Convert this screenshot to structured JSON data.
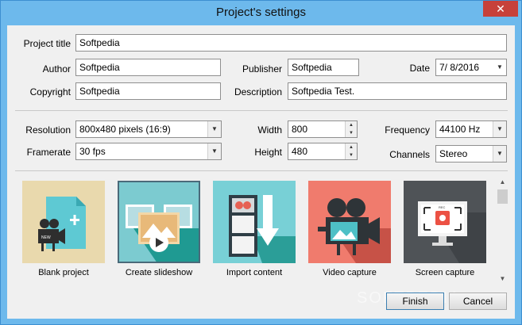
{
  "window": {
    "title": "Project's settings",
    "close_glyph": "✕"
  },
  "fields": {
    "project_title": {
      "label": "Project title",
      "value": "Softpedia"
    },
    "author": {
      "label": "Author",
      "value": "Softpedia"
    },
    "publisher": {
      "label": "Publisher",
      "value": "Softpedia"
    },
    "date": {
      "label": "Date",
      "value": "7/ 8/2016"
    },
    "copyright": {
      "label": "Copyright",
      "value": "Softpedia"
    },
    "description": {
      "label": "Description",
      "value": "Softpedia Test."
    }
  },
  "settings": {
    "resolution": {
      "label": "Resolution",
      "value": "800x480 pixels (16:9)"
    },
    "width": {
      "label": "Width",
      "value": "800"
    },
    "frequency": {
      "label": "Frequency",
      "value": "44100 Hz"
    },
    "framerate": {
      "label": "Framerate",
      "value": "30 fps"
    },
    "height": {
      "label": "Height",
      "value": "480"
    },
    "channels": {
      "label": "Channels",
      "value": "Stereo"
    }
  },
  "templates": [
    {
      "label": "Blank project",
      "icon": "blank-project-icon",
      "bg": "#e9d9ad",
      "accent": "#5ec9d3",
      "badge": "NEW"
    },
    {
      "label": "Create slideshow",
      "icon": "slideshow-icon",
      "bg": "#7ccbd0",
      "accent": "#1f9a92",
      "selected": true
    },
    {
      "label": "Import content",
      "icon": "import-content-icon",
      "bg": "#78d0d6",
      "accent": "#2b9e98"
    },
    {
      "label": "Video capture",
      "icon": "video-camera-icon",
      "bg": "#f07b6d",
      "accent": "#c75247"
    },
    {
      "label": "Screen capture",
      "icon": "screen-capture-icon",
      "bg": "#4f5357",
      "accent": "#ec5144",
      "badge": "REC"
    }
  ],
  "buttons": {
    "finish": "Finish",
    "cancel": "Cancel"
  },
  "watermark": "SOFTPEDIA"
}
